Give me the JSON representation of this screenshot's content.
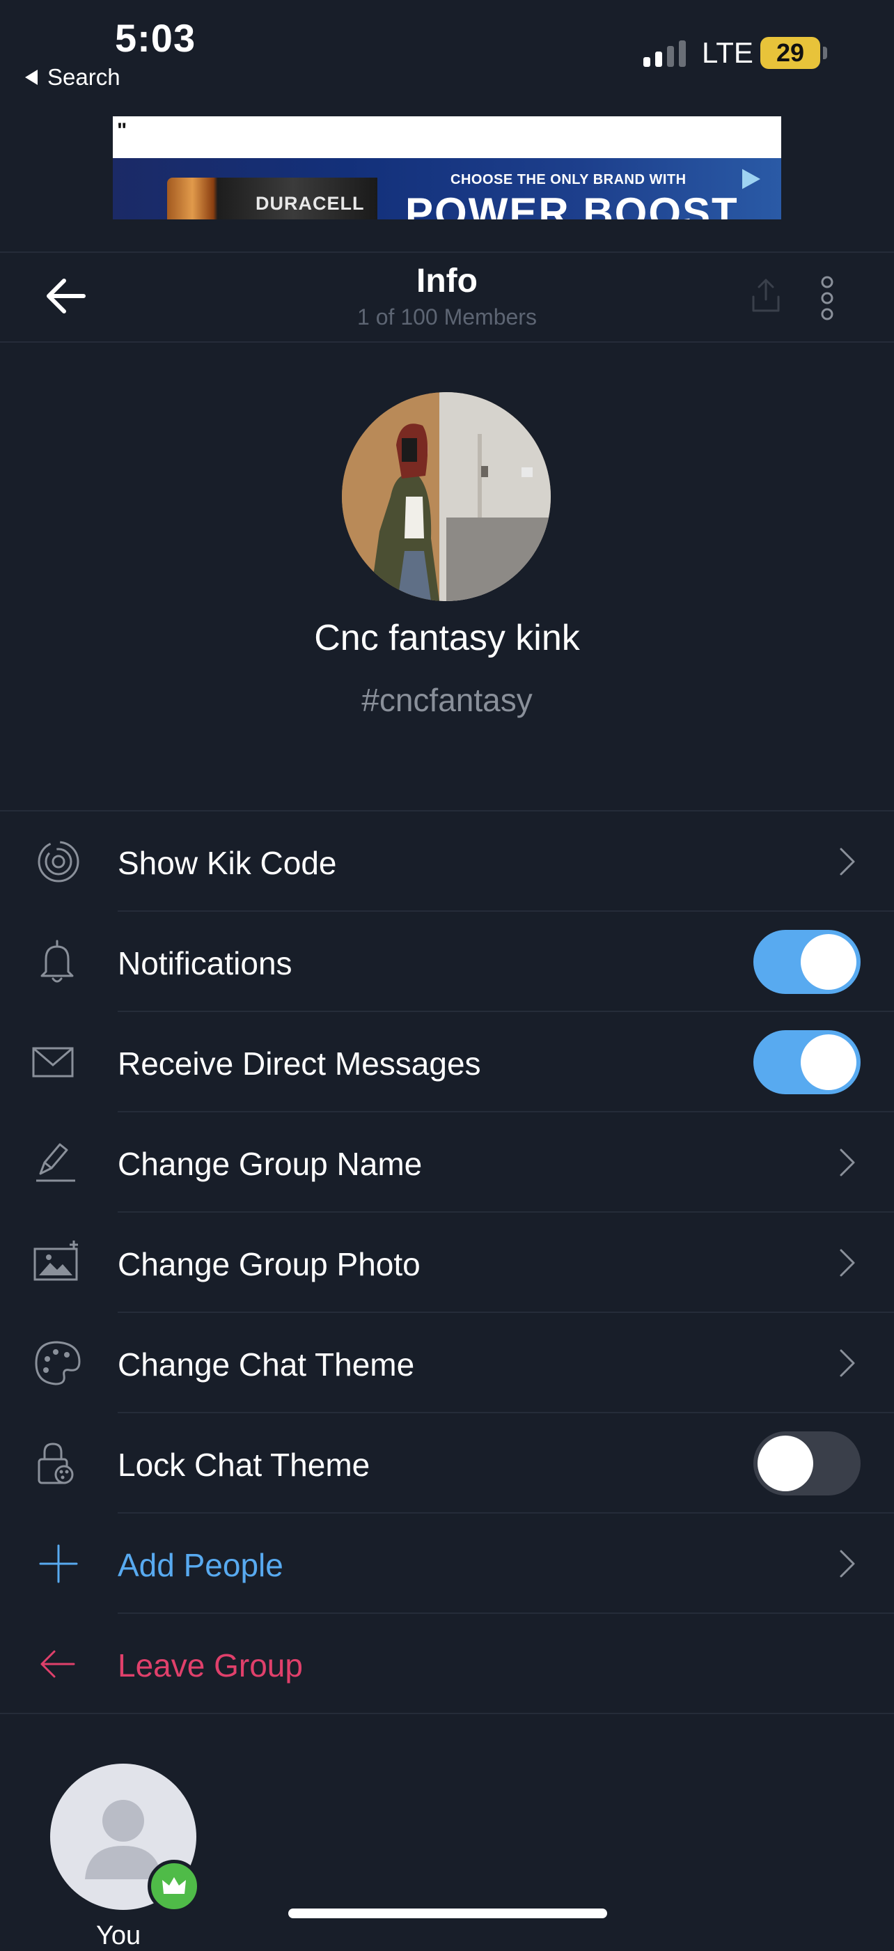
{
  "status_bar": {
    "time": "5:03",
    "back_label": "Search",
    "network": "LTE",
    "battery": "29"
  },
  "ad": {
    "quote_mark": "\"",
    "tagline": "CHOOSE THE ONLY BRAND WITH",
    "headline": "POWER BOOST",
    "brand": "DURACELL"
  },
  "header": {
    "title": "Info",
    "subtitle": "1 of 100 Members"
  },
  "group": {
    "name": "Cnc fantasy kink",
    "hashtag": "#cncfantasy"
  },
  "menu": [
    {
      "label": "Show Kik Code",
      "icon": "kik-code-icon",
      "control": "chevron"
    },
    {
      "label": "Notifications",
      "icon": "bell-icon",
      "control": "toggle",
      "enabled": true
    },
    {
      "label": "Receive Direct Messages",
      "icon": "envelope-icon",
      "control": "toggle",
      "enabled": true
    },
    {
      "label": "Change Group Name",
      "icon": "pencil-icon",
      "control": "chevron"
    },
    {
      "label": "Change Group Photo",
      "icon": "photo-icon",
      "control": "chevron"
    },
    {
      "label": "Change Chat Theme",
      "icon": "palette-icon",
      "control": "chevron"
    },
    {
      "label": "Lock Chat Theme",
      "icon": "lock-palette-icon",
      "control": "toggle",
      "enabled": false
    },
    {
      "label": "Add People",
      "icon": "plus-icon",
      "control": "chevron",
      "color": "#58aaf0"
    },
    {
      "label": "Leave Group",
      "icon": "arrow-left-icon",
      "control": "none",
      "color": "#e0406b"
    }
  ],
  "members": [
    {
      "label": "You",
      "badge": "crown-icon"
    }
  ],
  "colors": {
    "background": "#181e29",
    "accent": "#58aaf0",
    "danger": "#e0406b",
    "admin_badge": "#4fbb48"
  }
}
